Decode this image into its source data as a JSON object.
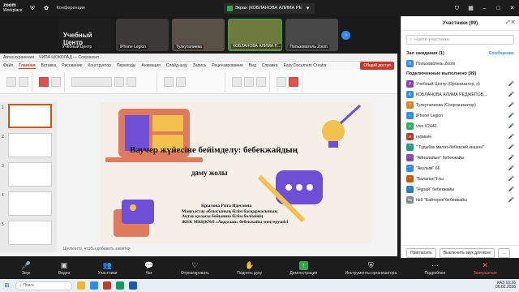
{
  "app": {
    "logo_line1": "zoom",
    "logo_line2": "Workplace"
  },
  "topbar": {
    "conference_label": "Конференция",
    "share_banner": "Экран (КОБЛАНОВА АЛИМА РЕ",
    "share_more": "Параметры демонстрации"
  },
  "videos": [
    {
      "name": "Учебный Центр",
      "center": "Учебный Центр"
    },
    {
      "name": "iPhone Legion"
    },
    {
      "name": "Тулкуталиева"
    },
    {
      "name": "КОБЛАНОВА АЛИМА Р..."
    },
    {
      "name": "Пользователь Zoom"
    }
  ],
  "ppt": {
    "autosave": "Автосохранение",
    "filename": "ЧИПА ШОКОЛАД — Сохранено",
    "tabs": [
      "Файл",
      "Главная",
      "Вставка",
      "Рисование",
      "Конструктор",
      "Переходы",
      "Анимация",
      "Слайд-шоу",
      "Запись",
      "Рецензирование",
      "Вид",
      "Справка",
      "Easy Document Creator"
    ],
    "active_tab": "Главная",
    "share_button": "Общий доступ",
    "slide": {
      "title": "Ваучер жүйесіне бейімделу: бебекжайдың",
      "subtitle": "даму жолы",
      "lines": [
        "Крылова Рита Идесовна",
        "Маңғыстау облысының білім басқармасының",
        "Ақтау қаласы бойынша білім бөлімінің",
        "ЖБК МКҚК№8 «Аққолан» бебекжайы меңгерушісі"
      ]
    },
    "notes": "Щелкните, чтобы добавить заметки"
  },
  "panel": {
    "title": "Участники (99)",
    "search_placeholder": "Найти участника",
    "waiting_section": "Зал ожидания (1)",
    "waiting_link": "Сообщение",
    "waiting_user": "Пользователь Zoom",
    "connected_section": "Подключенные выполнено (99)",
    "participants": [
      {
        "initial": "У",
        "name": "Учебный Центр (Организатор, я)",
        "color": "#8a3db6"
      },
      {
        "initial": "К",
        "name": "КОБЛАНОВА АЛИМА РЕДЖЕПОВ...",
        "color": "#2d8cff"
      },
      {
        "initial": "Т",
        "name": "Тулкуталиева (Соорганизатор)",
        "color": "#e67e22"
      },
      {
        "initial": "i",
        "name": "iPhone Legion",
        "color": "#2d8cff"
      },
      {
        "initial": "v",
        "name": "vivo V2441",
        "color": "#27ae60"
      },
      {
        "initial": "н",
        "name": "нурикин",
        "color": "#c0392b"
      },
      {
        "initial": "\"",
        "name": "\" Тудыбек милят-бебекскій кешені\"",
        "color": "#16a085"
      },
      {
        "initial": "\"",
        "name": "\"Айналайын\" бебекжайы",
        "color": "#8e44ad"
      },
      {
        "initial": "\"",
        "name": "\"Акулым\" 66",
        "color": "#2d8cff"
      },
      {
        "initial": "\"",
        "name": "\"Балапан\"Ғлы",
        "color": "#d35400"
      },
      {
        "initial": "\"",
        "name": "\"Нұрай\" бебекжайы",
        "color": "#2980b9"
      },
      {
        "initial": "№",
        "name": "№9 \"Байтерек\"бебекжайы",
        "color": "#7f8c8d"
      }
    ],
    "invite_button": "Пригласить",
    "mute_all_button": "Выключить звук для всех"
  },
  "bottombar": {
    "audio": "Звук",
    "video": "Видео",
    "participants": "Участники",
    "participants_count": "100",
    "chat": "Чат",
    "react": "Отреагировать",
    "raise": "Поднять руку",
    "share": "Демонстрация",
    "apps": "Инструменты организатора",
    "more": "Подробнее",
    "end": "Завершение"
  },
  "taskbar": {
    "search": "Поиск",
    "lang": "КАЗ",
    "time": "10:26",
    "date": "06.02.2026"
  },
  "colors": {
    "accent": "#2d8cff",
    "ppt_red": "#c13b2f",
    "share_green": "#2fa84f"
  }
}
